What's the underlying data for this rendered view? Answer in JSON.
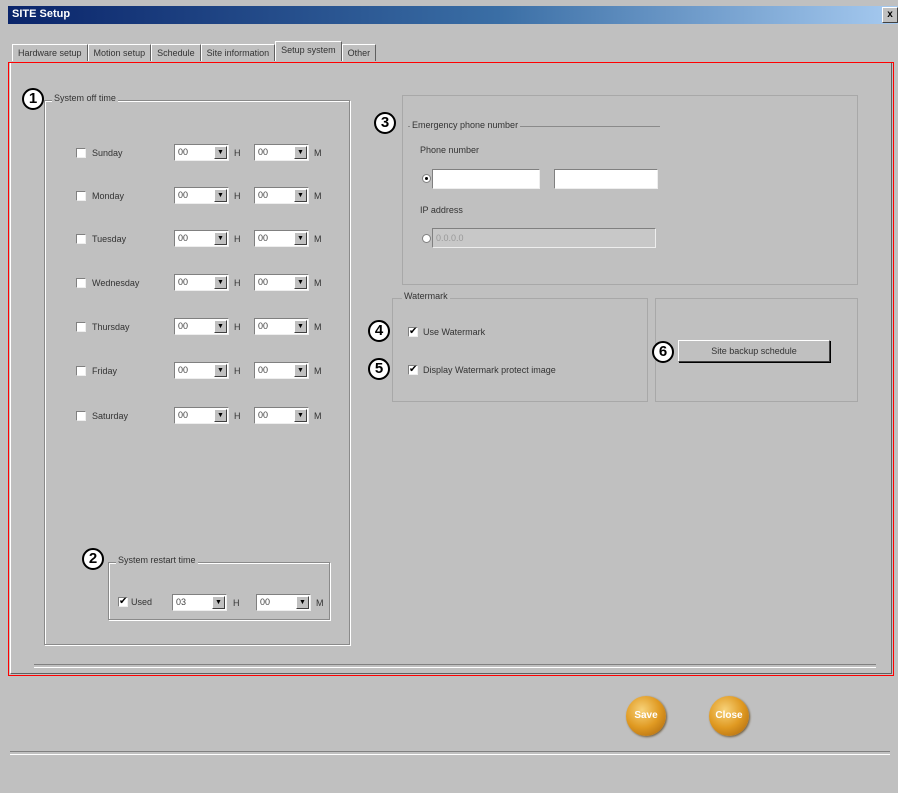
{
  "window": {
    "title": "SITE Setup",
    "close_label": "x"
  },
  "tabs": [
    {
      "label": "Hardware setup",
      "active": false
    },
    {
      "label": "Motion setup",
      "active": false
    },
    {
      "label": "Schedule",
      "active": false
    },
    {
      "label": "Site information",
      "active": false
    },
    {
      "label": "Setup system",
      "active": true
    },
    {
      "label": "Other",
      "active": false
    }
  ],
  "markers": [
    "1",
    "2",
    "3",
    "4",
    "5",
    "6"
  ],
  "system_off_time": {
    "title": "System off time",
    "hour_unit": "H",
    "minute_unit": "M",
    "days": [
      {
        "label": "Sunday",
        "checked": false,
        "hour": "00",
        "minute": "00"
      },
      {
        "label": "Monday",
        "checked": false,
        "hour": "00",
        "minute": "00"
      },
      {
        "label": "Tuesday",
        "checked": false,
        "hour": "00",
        "minute": "00"
      },
      {
        "label": "Wednesday",
        "checked": false,
        "hour": "00",
        "minute": "00"
      },
      {
        "label": "Thursday",
        "checked": false,
        "hour": "00",
        "minute": "00"
      },
      {
        "label": "Friday",
        "checked": false,
        "hour": "00",
        "minute": "00"
      },
      {
        "label": "Saturday",
        "checked": false,
        "hour": "00",
        "minute": "00"
      }
    ]
  },
  "system_restart": {
    "title": "System restart time",
    "used_label": "Used",
    "used_checked": true,
    "hour": "03",
    "minute": "00",
    "hour_unit": "H",
    "minute_unit": "M"
  },
  "emergency": {
    "title": "Emergency phone number",
    "phone_label": "Phone number",
    "phone_value_1": "",
    "phone_value_2": "",
    "ip_label": "IP address",
    "ip_value": "0.0.0.0",
    "selected": "phone"
  },
  "watermark": {
    "title": "Watermark",
    "use_label": "Use Watermark",
    "use_checked": true,
    "display_label": "Display Watermark protect image",
    "display_checked": true
  },
  "backup": {
    "button_label": "Site backup schedule"
  },
  "footer": {
    "save_label": "Save",
    "close_label": "Close"
  },
  "colors": {
    "accent_red": "#ff0000",
    "button_gold": "#e09a22",
    "titlebar_blue": "#0a246a"
  }
}
